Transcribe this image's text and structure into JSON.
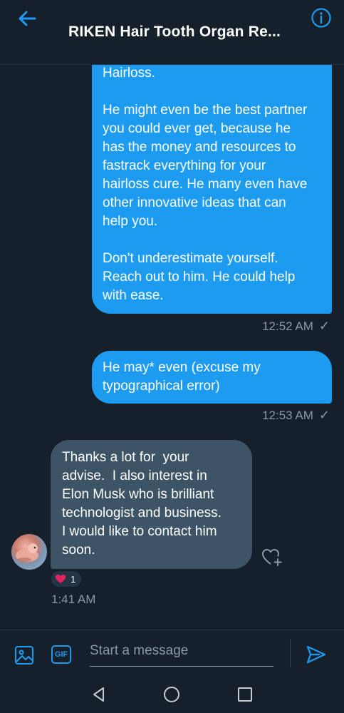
{
  "header": {
    "title": "RIKEN Hair Tooth Organ Re...",
    "back_icon": "arrow-left-icon",
    "info_icon": "info-icon"
  },
  "messages": [
    {
      "direction": "outgoing",
      "lines": [
        "Hairloss.",
        "",
        "He might even be the best partner",
        "you could ever get, because he",
        "has the money and resources to",
        "fastrack everything for your",
        "hairloss cure. He many even have",
        "other innovative ideas that can",
        "help you.",
        "",
        "Don't underestimate yourself.",
        "Reach out to him. He could help",
        "with ease."
      ],
      "time": "12:52 AM",
      "status": "✓"
    },
    {
      "direction": "outgoing",
      "lines": [
        "He may* even (excuse my",
        "typographical error)"
      ],
      "time": "12:53 AM",
      "status": "✓"
    },
    {
      "direction": "incoming",
      "lines": [
        "Thanks a lot for  your",
        "advise.  I also interest in",
        "Elon Musk who is brilliant",
        "technologist and business.",
        "I would like to contact him",
        "soon."
      ],
      "time": "1:41 AM",
      "reaction": {
        "icon": "heart-icon",
        "count": "1"
      }
    }
  ],
  "composer": {
    "placeholder": "Start a message",
    "gif_label": "GIF"
  },
  "colors": {
    "background": "#15202b",
    "outgoing_bubble": "#1d9bf0",
    "incoming_bubble": "#3d5466",
    "muted_text": "#8899a6",
    "heart": "#e0245e"
  }
}
